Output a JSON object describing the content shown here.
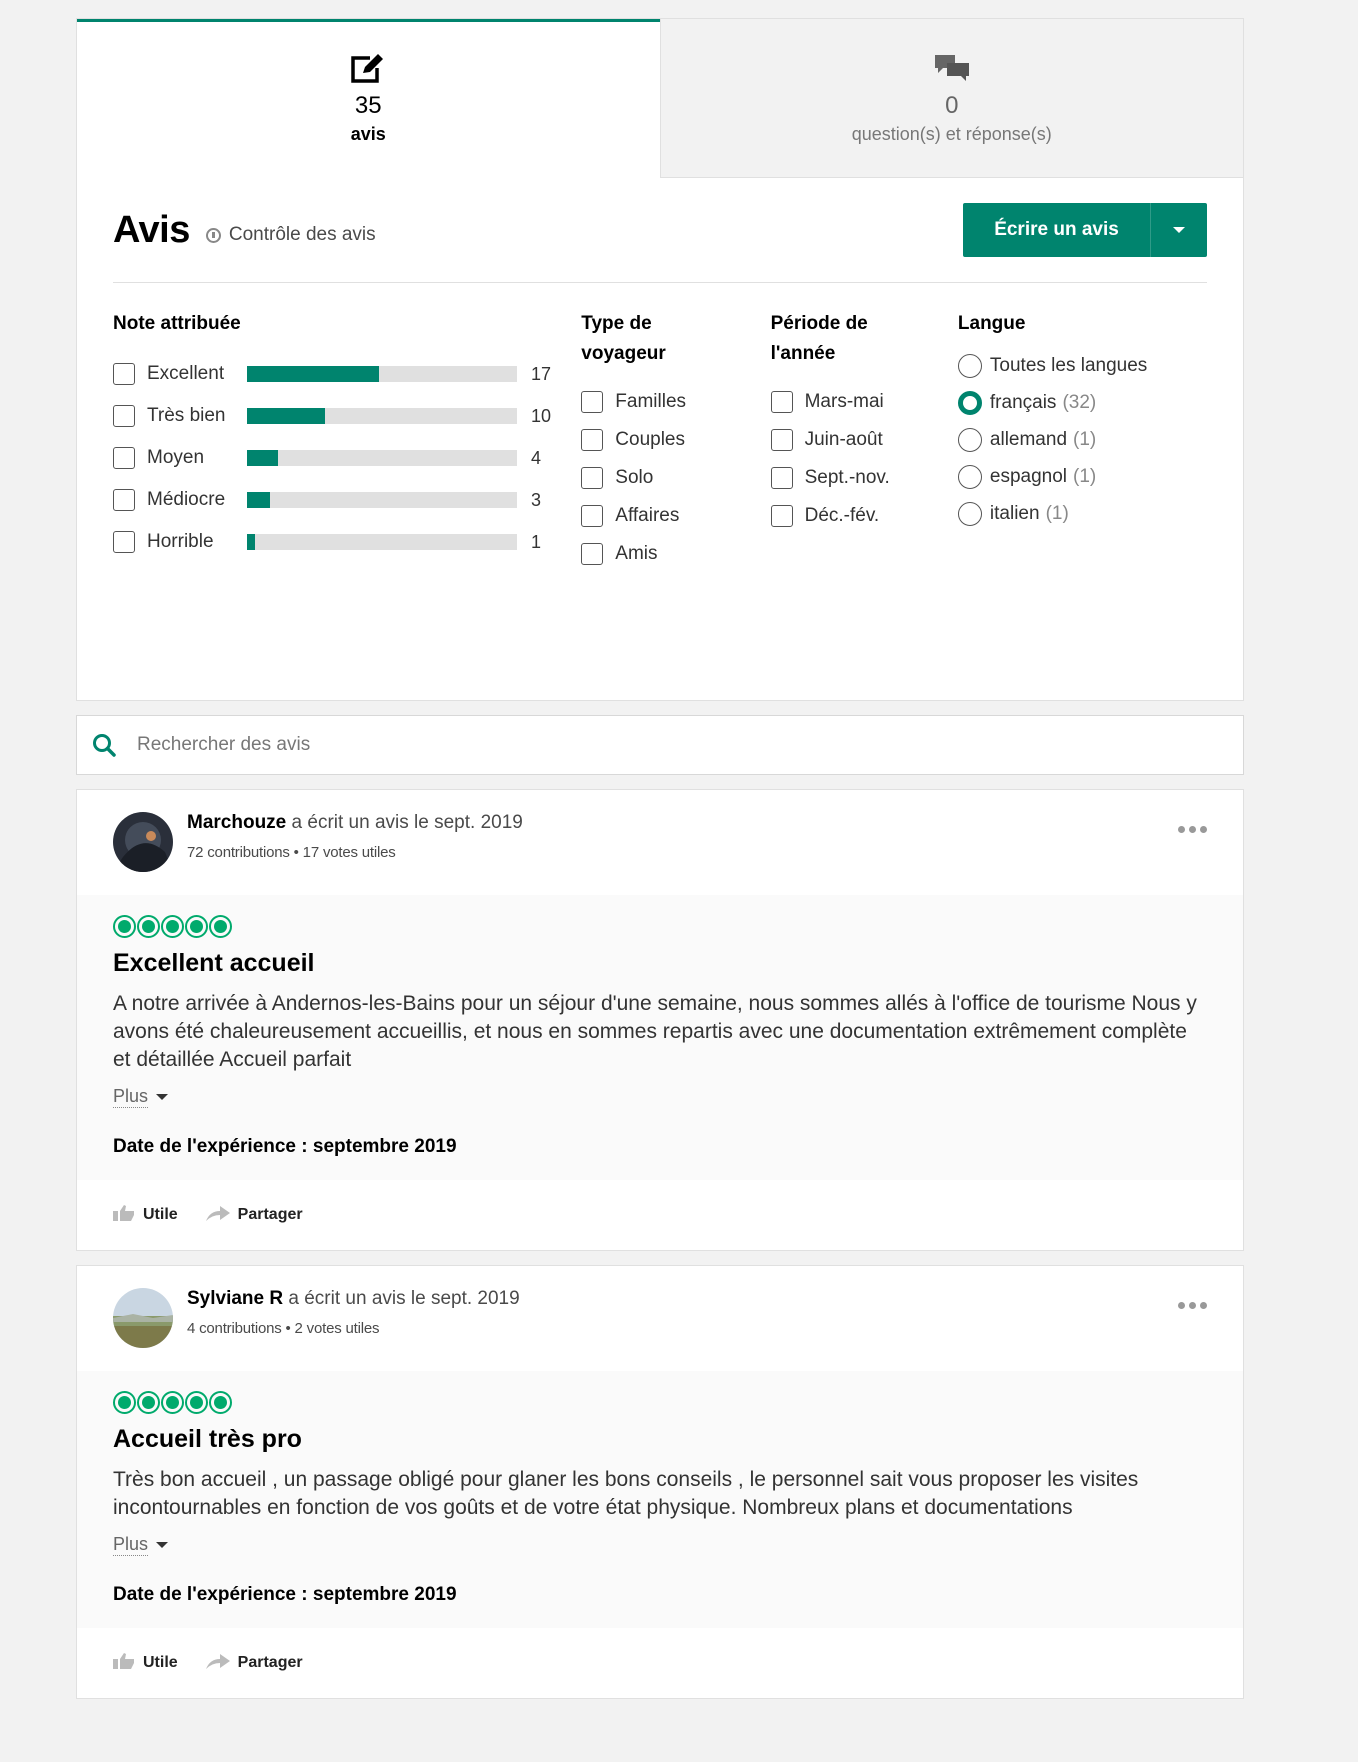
{
  "tabs": [
    {
      "count": "35",
      "label": "avis",
      "icon": "write-review-icon"
    },
    {
      "count": "0",
      "label": "question(s) et réponse(s)",
      "icon": "qa-bubbles-icon"
    }
  ],
  "header": {
    "title": "Avis",
    "control_label": "Contrôle des avis",
    "write_button": "Écrire un avis"
  },
  "filters": {
    "rating": {
      "heading": "Note attribuée",
      "items": [
        {
          "label": "Excellent",
          "count": "17",
          "fraction": 0.49
        },
        {
          "label": "Très bien",
          "count": "10",
          "fraction": 0.29
        },
        {
          "label": "Moyen",
          "count": "4",
          "fraction": 0.115
        },
        {
          "label": "Médiocre",
          "count": "3",
          "fraction": 0.086
        },
        {
          "label": "Horrible",
          "count": "1",
          "fraction": 0.029
        }
      ]
    },
    "traveler_type": {
      "heading": "Type de voyageur",
      "items": [
        "Familles",
        "Couples",
        "Solo",
        "Affaires",
        "Amis"
      ]
    },
    "period": {
      "heading": "Période de l'année",
      "items": [
        "Mars-mai",
        "Juin-août",
        "Sept.-nov.",
        "Déc.-fév."
      ]
    },
    "language": {
      "heading": "Langue",
      "items": [
        {
          "label": "Toutes les langues",
          "count": "",
          "selected": false
        },
        {
          "label": "français",
          "count": "(32)",
          "selected": true
        },
        {
          "label": "allemand",
          "count": "(1)",
          "selected": false
        },
        {
          "label": "espagnol",
          "count": "(1)",
          "selected": false
        },
        {
          "label": "italien",
          "count": "(1)",
          "selected": false
        }
      ]
    }
  },
  "search": {
    "placeholder": "Rechercher des avis"
  },
  "reviews": [
    {
      "author": "Marchouze",
      "wrote": "a écrit un avis le sept. 2019",
      "stats": "72 contributions • 17 votes utiles",
      "rating": 5,
      "title": "Excellent accueil",
      "text": "A notre arrivée à Andernos-les-Bains pour un séjour d'une semaine, nous sommes allés à l'office de tourisme Nous y avons été chaleureusement accueillis, et nous en sommes repartis avec une documentation extrêmement complète et détaillée Accueil parfait",
      "more": "Plus",
      "date_label": "Date de l'expérience :",
      "date_value": "septembre 2019",
      "useful": "Utile",
      "share": "Partager"
    },
    {
      "author": "Sylviane R",
      "wrote": "a écrit un avis le sept. 2019",
      "stats": "4 contributions • 2 votes utiles",
      "rating": 5,
      "title": "Accueil très pro",
      "text": "Très bon accueil , un passage obligé pour glaner les bons conseils , le personnel sait vous proposer les visites incontournables en fonction de vos goûts et de votre état physique. Nombreux plans et documentations",
      "more": "Plus",
      "date_label": "Date de l'expérience :",
      "date_value": "septembre 2019",
      "useful": "Utile",
      "share": "Partager"
    }
  ],
  "colors": {
    "accent": "#00846e",
    "bubble": "#00aa6c"
  }
}
